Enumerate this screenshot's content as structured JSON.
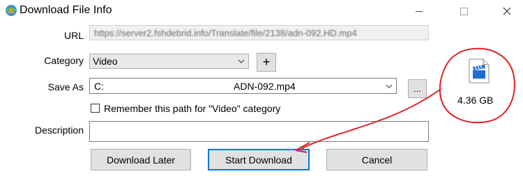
{
  "window": {
    "title": "Download File Info",
    "icon": "idm-globe-icon",
    "controls": [
      "minimize",
      "maximize",
      "close"
    ]
  },
  "url": {
    "label": "URL",
    "value": "https://server2.fshdebrid.info/Translate/file/2138/adn-092.HD.mp4"
  },
  "category": {
    "label": "Category",
    "selected": "Video",
    "add_label": "+"
  },
  "save_as": {
    "label": "Save As",
    "value_prefix": "C:",
    "value_suffix": "ADN-092.mp4",
    "browse_label": "..."
  },
  "remember": {
    "label": "Remember this path for \"Video\" category",
    "checked": false
  },
  "description": {
    "label": "Description",
    "value": ""
  },
  "file": {
    "icon": "video-file-icon",
    "size": "4.36  GB"
  },
  "buttons": {
    "download_later": "Download Later",
    "start_download": "Start Download",
    "cancel": "Cancel"
  },
  "annotation": {
    "color": "#e02020"
  }
}
